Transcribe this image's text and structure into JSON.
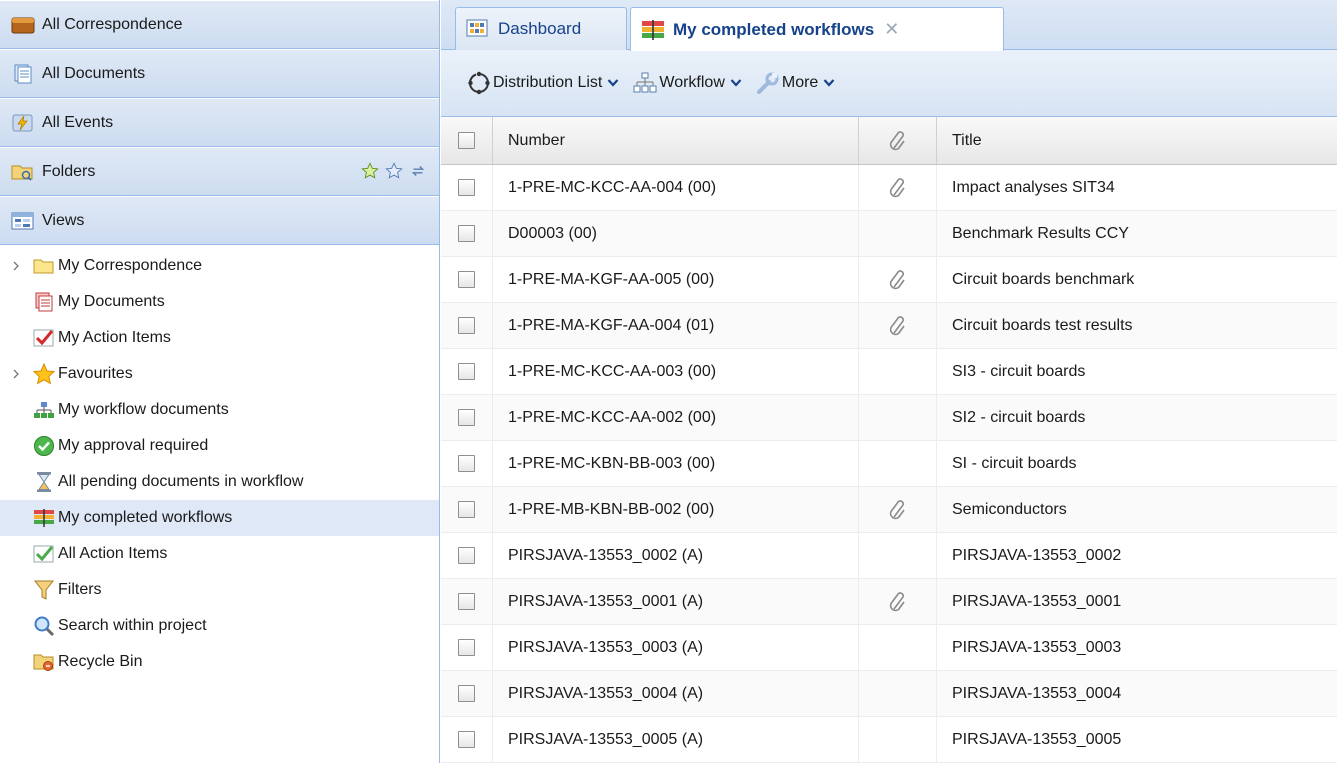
{
  "sidebar": {
    "sections": [
      {
        "label": "All Correspondence",
        "icon": "folder-drawer-icon"
      },
      {
        "label": "All Documents",
        "icon": "documents-icon"
      },
      {
        "label": "All Events",
        "icon": "events-icon"
      },
      {
        "label": "Folders",
        "icon": "folders-icon"
      },
      {
        "label": "Views",
        "icon": "views-icon"
      }
    ],
    "tree": [
      {
        "label": "My Correspondence",
        "icon": "folder-icon",
        "expandable": true
      },
      {
        "label": "My Documents",
        "icon": "documents-stack-icon",
        "expandable": false
      },
      {
        "label": "My Action Items",
        "icon": "checkmark-icon",
        "expandable": false
      },
      {
        "label": "Favourites",
        "icon": "star-icon",
        "expandable": true
      },
      {
        "label": "My workflow documents",
        "icon": "workflow-icon",
        "expandable": false
      },
      {
        "label": "My approval required",
        "icon": "approval-icon",
        "expandable": false
      },
      {
        "label": "All pending documents in workflow",
        "icon": "hourglass-icon",
        "expandable": false
      },
      {
        "label": "My completed workflows",
        "icon": "completed-workflows-icon",
        "expandable": false,
        "selected": true
      },
      {
        "label": "All Action Items",
        "icon": "checkbox-checked-icon",
        "expandable": false
      },
      {
        "label": "Filters",
        "icon": "filter-icon",
        "expandable": false
      },
      {
        "label": "Search within project",
        "icon": "magnifier-icon",
        "expandable": false
      },
      {
        "label": "Recycle Bin",
        "icon": "recycle-bin-icon",
        "expandable": false
      }
    ]
  },
  "tabs": [
    {
      "label": "Dashboard",
      "icon": "dashboard-icon",
      "active": false
    },
    {
      "label": "My completed workflows",
      "icon": "completed-workflows-icon",
      "active": true,
      "close": "✕"
    }
  ],
  "toolbar": {
    "distribution": "Distribution List",
    "workflow": "Workflow",
    "more": "More"
  },
  "grid": {
    "columns": {
      "number": "Number",
      "title": "Title"
    },
    "rows": [
      {
        "number": "1-PRE-MC-KCC-AA-004 (00)",
        "attachment": true,
        "title": "Impact analyses SIT34"
      },
      {
        "number": "D00003 (00)",
        "attachment": false,
        "title": "Benchmark Results CCY"
      },
      {
        "number": "1-PRE-MA-KGF-AA-005 (00)",
        "attachment": true,
        "title": "Circuit boards benchmark"
      },
      {
        "number": "1-PRE-MA-KGF-AA-004 (01)",
        "attachment": true,
        "title": "Circuit boards test results"
      },
      {
        "number": "1-PRE-MC-KCC-AA-003 (00)",
        "attachment": false,
        "title": "SI3 - circuit boards"
      },
      {
        "number": "1-PRE-MC-KCC-AA-002 (00)",
        "attachment": false,
        "title": "SI2 - circuit boards"
      },
      {
        "number": "1-PRE-MC-KBN-BB-003 (00)",
        "attachment": false,
        "title": "SI - circuit boards"
      },
      {
        "number": "1-PRE-MB-KBN-BB-002 (00)",
        "attachment": true,
        "title": "Semiconductors"
      },
      {
        "number": "PIRSJAVA-13553_0002 (A)",
        "attachment": false,
        "title": "PIRSJAVA-13553_0002"
      },
      {
        "number": "PIRSJAVA-13553_0001 (A)",
        "attachment": true,
        "title": "PIRSJAVA-13553_0001"
      },
      {
        "number": "PIRSJAVA-13553_0003 (A)",
        "attachment": false,
        "title": "PIRSJAVA-13553_0003"
      },
      {
        "number": "PIRSJAVA-13553_0004 (A)",
        "attachment": false,
        "title": "PIRSJAVA-13553_0004"
      },
      {
        "number": "PIRSJAVA-13553_0005 (A)",
        "attachment": false,
        "title": "PIRSJAVA-13553_0005"
      }
    ]
  }
}
